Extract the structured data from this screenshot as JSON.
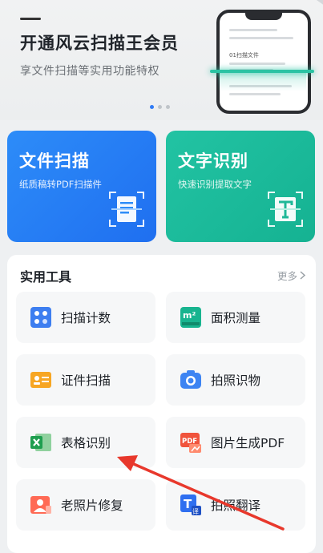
{
  "banner": {
    "title": "开通风云扫描王会员",
    "subtitle": "享文件扫描等实用功能特权",
    "carousel": {
      "count": 3,
      "active": 0
    },
    "phone_doc_title": "01扫描文件"
  },
  "features": [
    {
      "title": "文件扫描",
      "subtitle": "纸质稿转PDF扫描件",
      "icon": "document-scan-icon",
      "color": "#2a85f6"
    },
    {
      "title": "文字识别",
      "subtitle": "快速识别提取文字",
      "icon": "text-recognition-icon",
      "color": "#1dbd9d"
    }
  ],
  "tools": {
    "title": "实用工具",
    "more_label": "更多",
    "items": [
      {
        "label": "扫描计数",
        "icon": "counting-icon"
      },
      {
        "label": "面积测量",
        "icon": "area-measure-icon"
      },
      {
        "label": "证件扫描",
        "icon": "id-card-icon"
      },
      {
        "label": "拍照识物",
        "icon": "camera-icon"
      },
      {
        "label": "表格识别",
        "icon": "excel-icon"
      },
      {
        "label": "图片生成PDF",
        "icon": "pdf-icon"
      },
      {
        "label": "老照片修复",
        "icon": "photo-repair-icon"
      },
      {
        "label": "拍照翻译",
        "icon": "translate-icon"
      }
    ]
  },
  "icon_labels": {
    "m2": "m²",
    "pdf": "PDF",
    "translate": "译",
    "t": "T"
  }
}
